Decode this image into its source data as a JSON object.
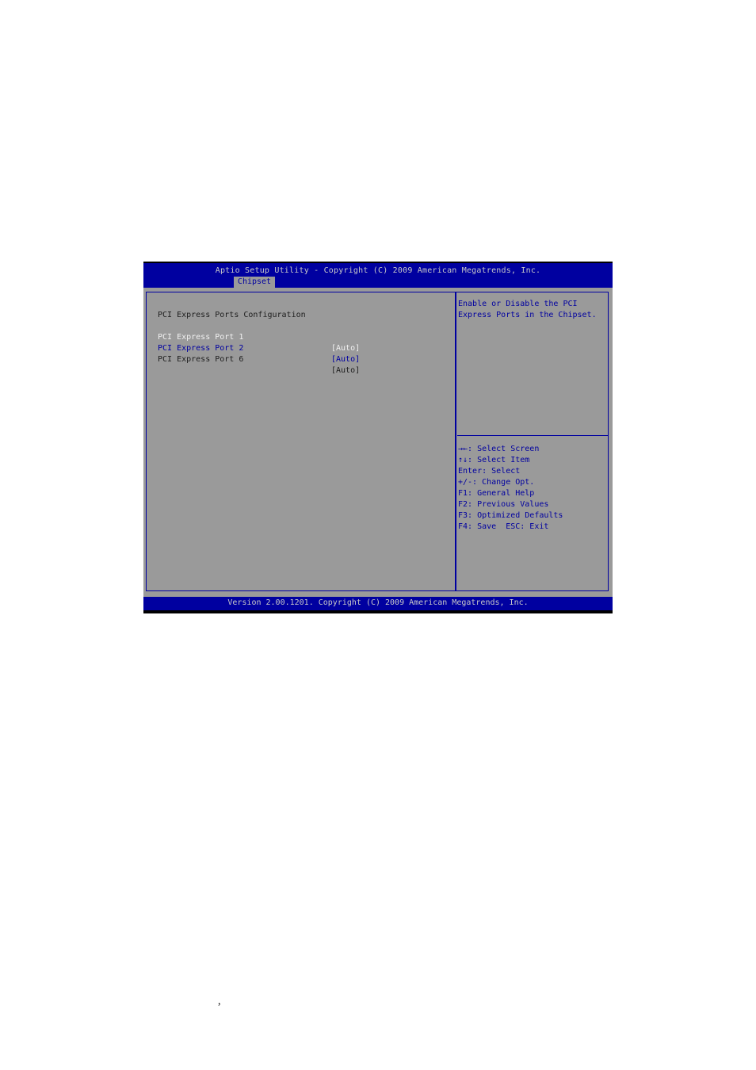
{
  "header": {
    "title": "Aptio Setup Utility - Copyright (C) 2009 American Megatrends, Inc.",
    "active_tab": "Chipset"
  },
  "main": {
    "section_title": "PCI Express Ports Configuration",
    "items": [
      {
        "label": "PCI Express Port 1",
        "value": "[Auto]",
        "state": "highlighted"
      },
      {
        "label": "PCI Express Port 2",
        "value": "[Auto]",
        "state": "selectable"
      },
      {
        "label": "PCI Express Port 6",
        "value": "[Auto]",
        "state": "normal"
      }
    ]
  },
  "help": {
    "lines": [
      "Enable or Disable the PCI",
      "Express Ports in the Chipset."
    ]
  },
  "keys": [
    "→←: Select Screen",
    "↑↓: Select Item",
    "Enter: Select",
    "+/-: Change Opt.",
    "F1: General Help",
    "F2: Previous Values",
    "F3: Optimized Defaults",
    "F4: Save  ESC: Exit"
  ],
  "footer": {
    "text": "Version 2.00.1201. Copyright (C) 2009 American Megatrends, Inc."
  },
  "page": {
    "stray_mark": ","
  },
  "colors": {
    "header_bg": "#0000a0",
    "body_bg": "#9a9a9a",
    "highlight_text": "#f0f0f0",
    "accent_text": "#0000a0"
  }
}
